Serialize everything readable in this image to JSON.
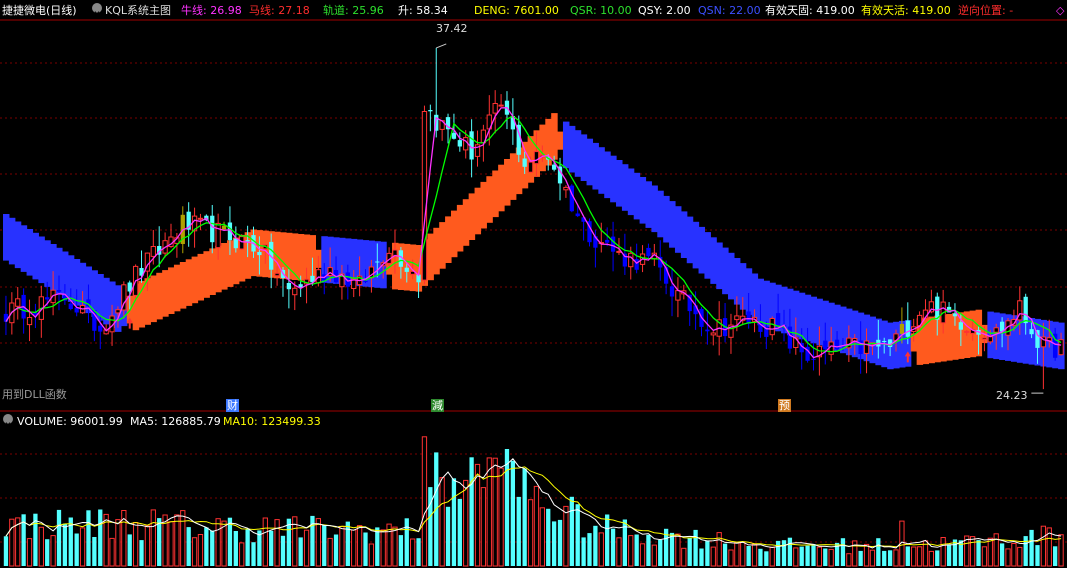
{
  "header": {
    "title": "捷捷微电(日线)",
    "indicator": "KQL系统主图",
    "niu_label": "牛线: 26.98",
    "ma_label": "马线: 27.18",
    "gui_label": "轨道: 25.96",
    "sheng_label": "升: 58.34",
    "deng_label": "DENG: 7601.00",
    "qsr_label": "QSR: 10.00",
    "qsy_label": "QSY: 2.00",
    "qsn_label": "QSN: 22.00",
    "ytg_label": "有效天固: 419.00",
    "yth_label": "有效天活: 419.00",
    "nxwz_label": "逆向位置: -",
    "diamond": "◇"
  },
  "volume_header": {
    "volume_label": "VOLUME: 96001.99",
    "ma5_label": "MA5: 126885.79",
    "ma10_label": "MA10: 123499.33"
  },
  "annotations": {
    "dll_text": "用到DLL函数",
    "high_label": "37.42",
    "low_label": "24.23",
    "tag_cai": "财",
    "tag_jian": "減",
    "tag_yu": "预"
  },
  "colors": {
    "up": "#ff3232",
    "down": "#54ffff",
    "deep_down": "#0000ff",
    "gold": "#b0a000",
    "niu": "#ff32ff",
    "ma": "#ff0000",
    "gui": "#00ff00",
    "band_up": "#ff5a1e",
    "band_down": "#2832ff",
    "grid": "#7a0000",
    "ma5": "#ffffff",
    "ma10": "#ffff00"
  },
  "chart_data": {
    "type": "candlestick",
    "y_range": [
      23.5,
      38.5
    ],
    "anchors": [
      {
        "i": 0,
        "v": 27.2
      },
      {
        "i": 10,
        "v": 27.8
      },
      {
        "i": 16,
        "v": 26.6
      },
      {
        "i": 22,
        "v": 28.6
      },
      {
        "i": 30,
        "v": 30.6
      },
      {
        "i": 37,
        "v": 30.2
      },
      {
        "i": 43,
        "v": 29.7
      },
      {
        "i": 48,
        "v": 28.0
      },
      {
        "i": 55,
        "v": 28.9
      },
      {
        "i": 60,
        "v": 28.2
      },
      {
        "i": 65,
        "v": 29.8
      },
      {
        "i": 70,
        "v": 28.6
      },
      {
        "i": 71,
        "v": 35.2
      },
      {
        "i": 73,
        "v": 34.6
      },
      {
        "i": 79,
        "v": 33.4
      },
      {
        "i": 84,
        "v": 35.2
      },
      {
        "i": 88,
        "v": 33.0
      },
      {
        "i": 92,
        "v": 33.3
      },
      {
        "i": 98,
        "v": 30.5
      },
      {
        "i": 104,
        "v": 29.4
      },
      {
        "i": 110,
        "v": 29.1
      },
      {
        "i": 114,
        "v": 27.8
      },
      {
        "i": 120,
        "v": 26.6
      },
      {
        "i": 126,
        "v": 26.9
      },
      {
        "i": 130,
        "v": 26.6
      },
      {
        "i": 136,
        "v": 25.5
      },
      {
        "i": 142,
        "v": 25.8
      },
      {
        "i": 150,
        "v": 25.9
      },
      {
        "i": 156,
        "v": 27.5
      },
      {
        "i": 163,
        "v": 26.8
      },
      {
        "i": 168,
        "v": 26.4
      },
      {
        "i": 172,
        "v": 27.3
      },
      {
        "i": 176,
        "v": 25.8
      },
      {
        "i": 179,
        "v": 25.9
      }
    ],
    "band_anchors": [
      {
        "i": 0,
        "v": 30.1
      },
      {
        "i": 20,
        "v": 27.2
      },
      {
        "i": 42,
        "v": 29.5
      },
      {
        "i": 70,
        "v": 28.9
      },
      {
        "i": 93,
        "v": 34.0
      },
      {
        "i": 110,
        "v": 31.2
      },
      {
        "i": 128,
        "v": 27.6
      },
      {
        "i": 150,
        "v": 25.9
      },
      {
        "i": 165,
        "v": 26.4
      },
      {
        "i": 179,
        "v": 25.9
      }
    ],
    "band_cross": [
      {
        "i": 0,
        "v": -1
      },
      {
        "i": 19,
        "v": -1
      },
      {
        "i": 22,
        "v": 1
      },
      {
        "i": 52,
        "v": 1
      },
      {
        "i": 54,
        "v": -1
      },
      {
        "i": 64,
        "v": -1
      },
      {
        "i": 66,
        "v": 1
      },
      {
        "i": 93,
        "v": 1
      },
      {
        "i": 95,
        "v": -1
      },
      {
        "i": 153,
        "v": -1
      },
      {
        "i": 155,
        "v": 1
      },
      {
        "i": 165,
        "v": 1
      },
      {
        "i": 167,
        "v": -1
      },
      {
        "i": 179,
        "v": -1
      }
    ],
    "volume_anchors": [
      {
        "i": 0,
        "v": 0.3
      },
      {
        "i": 20,
        "v": 0.32
      },
      {
        "i": 40,
        "v": 0.28
      },
      {
        "i": 70,
        "v": 0.26
      },
      {
        "i": 71,
        "v": 0.95
      },
      {
        "i": 72,
        "v": 0.6
      },
      {
        "i": 84,
        "v": 0.68
      },
      {
        "i": 90,
        "v": 0.5
      },
      {
        "i": 100,
        "v": 0.28
      },
      {
        "i": 130,
        "v": 0.15
      },
      {
        "i": 155,
        "v": 0.15
      },
      {
        "i": 179,
        "v": 0.22
      }
    ],
    "candle_count": 180,
    "high": 37.42,
    "low": 24.23,
    "xlabel": "",
    "ylabel": ""
  }
}
